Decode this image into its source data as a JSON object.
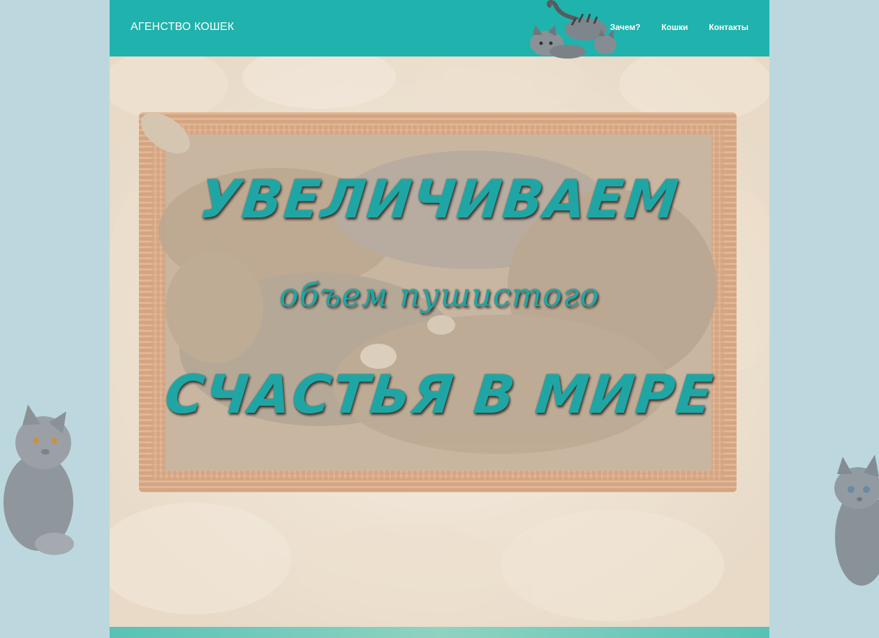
{
  "header": {
    "brand": "АГЕНСТВО КОШЕК",
    "nav": [
      {
        "label": "Зачем?"
      },
      {
        "label": "Кошки"
      },
      {
        "label": "Контакты"
      }
    ]
  },
  "hero": {
    "line1": "УВЕЛИЧИВАЕМ",
    "line2": "объем пушистого",
    "line3": "СЧАСТЬЯ В МИРЕ"
  },
  "colors": {
    "page_bg": "#bcd8de",
    "header_bg": "#20b2ac",
    "hero_text": "#1fa6a4",
    "basket": "#c8875a"
  },
  "icons": {
    "header_decoration": "walking-cat-icon",
    "left_decoration": "sitting-gray-cat-icon",
    "right_decoration": "gray-kitten-icon"
  }
}
